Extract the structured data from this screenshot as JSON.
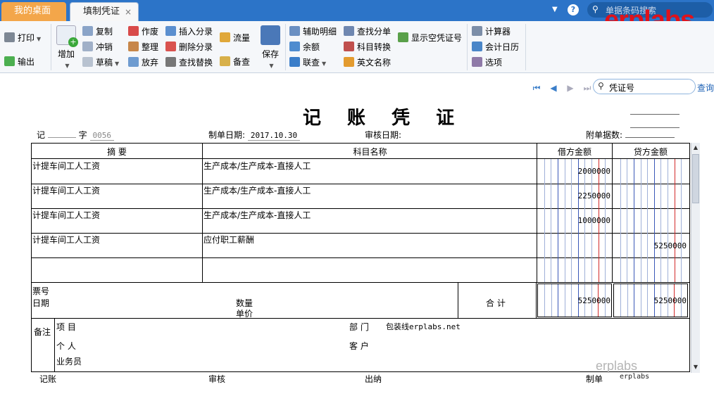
{
  "tabs": [
    {
      "label": "我的桌面"
    },
    {
      "label": "填制凭证",
      "close": "×"
    }
  ],
  "titlebar": {
    "search_placeholder": "单据条码搜索",
    "help": "?",
    "brand": "erplabs"
  },
  "ribbon": {
    "print": "打印",
    "export": "输出",
    "add": "增加",
    "copy": "复制",
    "reverse": "冲销",
    "draft": "草稿",
    "void": "作废",
    "organize": "整理",
    "discard": "放弃",
    "insert_entry": "插入分录",
    "delete_entry": "删除分录",
    "find_replace": "查找替换",
    "flow": "流量",
    "memo": "备查",
    "save": "保存",
    "aux_detail": "辅助明细",
    "balance": "余额",
    "link_query": "联查",
    "find_entry": "查找分单",
    "subject_convert": "科目转换",
    "english_name": "英文名称",
    "show_empty_voucher": "显示空凭证号",
    "calculator": "计算器",
    "calendar": "会计日历",
    "options": "选项"
  },
  "nav": {
    "search_value": "凭证号",
    "query": "查询"
  },
  "voucher": {
    "title": "记 账 凭 证",
    "type_label": "记",
    "zi_label": "字",
    "voucher_no": "0056",
    "date_label": "制单日期:",
    "date_value": "2017.10.30",
    "audit_date_label": "审核日期:",
    "attachments_label": "附单据数:",
    "headers": {
      "summary": "摘 要",
      "account": "科目名称",
      "debit": "借方金额",
      "credit": "贷方金额"
    },
    "rows": [
      {
        "summary": "计提车间工人工资",
        "account": "生产成本/生产成本-直接人工",
        "debit": "2000000",
        "credit": ""
      },
      {
        "summary": "计提车间工人工资",
        "account": "生产成本/生产成本-直接人工",
        "debit": "2250000",
        "credit": ""
      },
      {
        "summary": "计提车间工人工资",
        "account": "生产成本/生产成本-直接人工",
        "debit": "1000000",
        "credit": ""
      },
      {
        "summary": "计提车间工人工资",
        "account": "应付职工薪酬",
        "debit": "",
        "credit": "5250000"
      },
      {
        "summary": "",
        "account": "",
        "debit": "",
        "credit": ""
      }
    ],
    "ticket_label": "票号",
    "date_row_label": "日期",
    "qty_label": "数量",
    "price_label": "单价",
    "total_label": "合 计",
    "total_debit": "5250000",
    "total_credit": "5250000",
    "remark_label": "备注",
    "project_label": "项 目",
    "dept_label": "部 门",
    "dept_value": "包装线erplabs.net",
    "person_label": "个 人",
    "customer_label": "客 户",
    "salesman_label": "业务员"
  },
  "footer": {
    "bookkeeper": "记账",
    "auditor": "审核",
    "cashier": "出纳",
    "maker": "制单",
    "maker_value": "erplabs",
    "watermark": "erplabs"
  },
  "colors": {
    "titlebar": "#2c74c8",
    "home_tab": "#f3a64a",
    "brand": "#e0121b",
    "amount_blue_line": "#3a58b8",
    "amount_red_line": "#d22a2a"
  }
}
